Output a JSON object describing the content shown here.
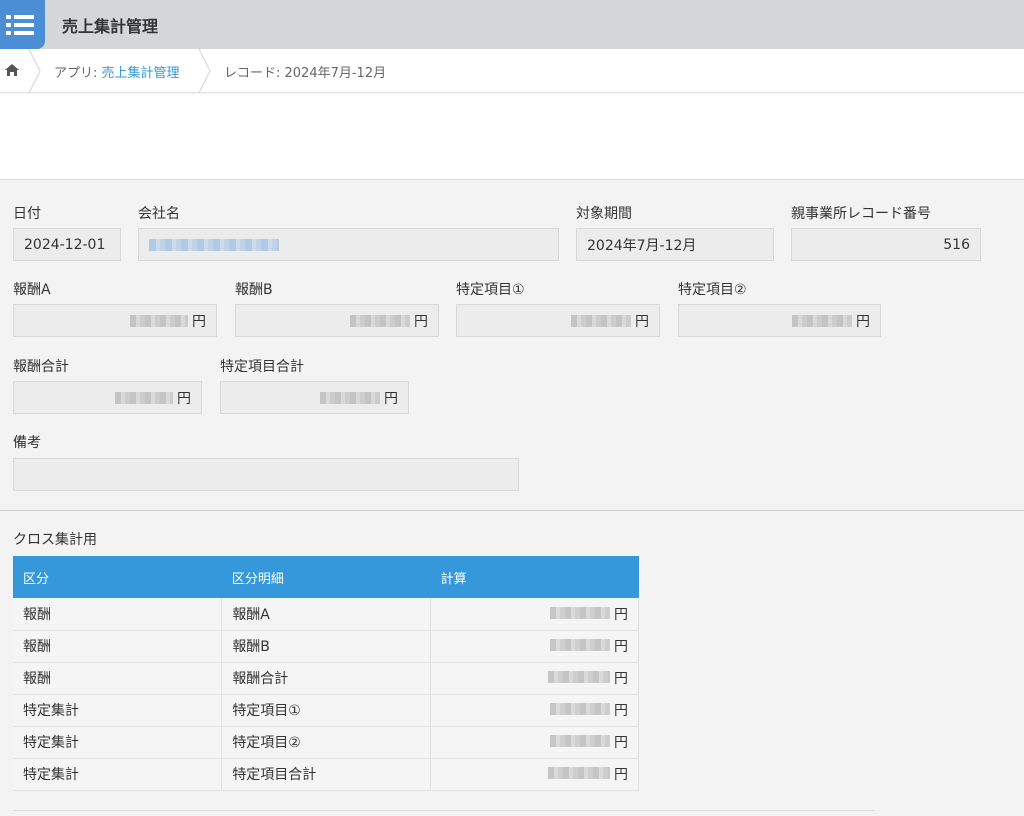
{
  "app": {
    "title": "売上集計管理"
  },
  "breadcrumb": {
    "app_prefix": "アプリ: ",
    "app_link": "売上集計管理",
    "record": "レコード: 2024年7月-12月"
  },
  "fields": {
    "date": {
      "label": "日付",
      "value": "2024-12-01"
    },
    "company": {
      "label": "会社名"
    },
    "period": {
      "label": "対象期間",
      "value": "2024年7月-12月"
    },
    "parent_record": {
      "label": "親事業所レコード番号",
      "value": "516"
    },
    "reward_a": {
      "label": "報酬A",
      "unit": "円"
    },
    "reward_b": {
      "label": "報酬B",
      "unit": "円"
    },
    "item_1": {
      "label": "特定項目①",
      "unit": "円"
    },
    "item_2": {
      "label": "特定項目②",
      "unit": "円"
    },
    "reward_total": {
      "label": "報酬合計",
      "unit": "円"
    },
    "item_total": {
      "label": "特定項目合計",
      "unit": "円"
    },
    "remarks": {
      "label": "備考",
      "value": ""
    }
  },
  "cross": {
    "title": "クロス集計用",
    "headers": [
      "区分",
      "区分明細",
      "計算"
    ],
    "rows": [
      {
        "category": "報酬",
        "detail": "報酬A",
        "unit": "円"
      },
      {
        "category": "報酬",
        "detail": "報酬B",
        "unit": "円"
      },
      {
        "category": "報酬",
        "detail": "報酬合計",
        "unit": "円"
      },
      {
        "category": "特定集計",
        "detail": "特定項目①",
        "unit": "円"
      },
      {
        "category": "特定集計",
        "detail": "特定項目②",
        "unit": "円"
      },
      {
        "category": "特定集計",
        "detail": "特定項目合計",
        "unit": "円"
      }
    ]
  },
  "colors": {
    "header_blue": "#3498db",
    "link_blue": "#3498db",
    "topbar": "#d4d7d8"
  },
  "icons": {
    "app": "list-app-icon",
    "home": "home-icon",
    "separator": "chevron-separator"
  }
}
